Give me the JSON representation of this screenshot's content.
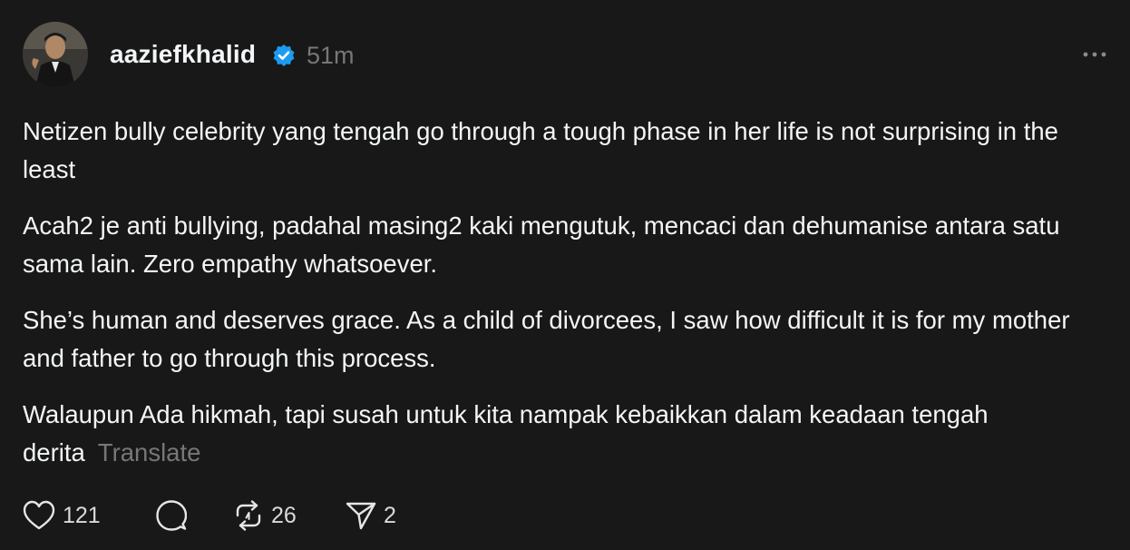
{
  "post": {
    "username": "aaziefkhalid",
    "time": "51m",
    "avatar_icon": "profile-photo",
    "paragraphs": [
      "Netizen bully celebrity yang tengah go through a tough phase in her life is not surprising in the least",
      "Acah2 je anti bullying, padahal masing2 kaki mengutuk, mencaci dan dehumanise antara satu sama lain. Zero empathy whatsoever.",
      "She’s human and deserves grace. As a child of divorcees, I saw how difficult it is for my mother and father to go through this process.",
      "Walaupun Ada hikmah, tapi susah untuk kita nampak kebaikkan dalam keadaan tengah derita"
    ],
    "translate_label": "Translate",
    "likes": "121",
    "reposts": "26",
    "shares": "2"
  },
  "colors": {
    "background": "#181818",
    "text": "#f3f5f7",
    "muted": "#777777",
    "verified": "#1d9bf0"
  }
}
